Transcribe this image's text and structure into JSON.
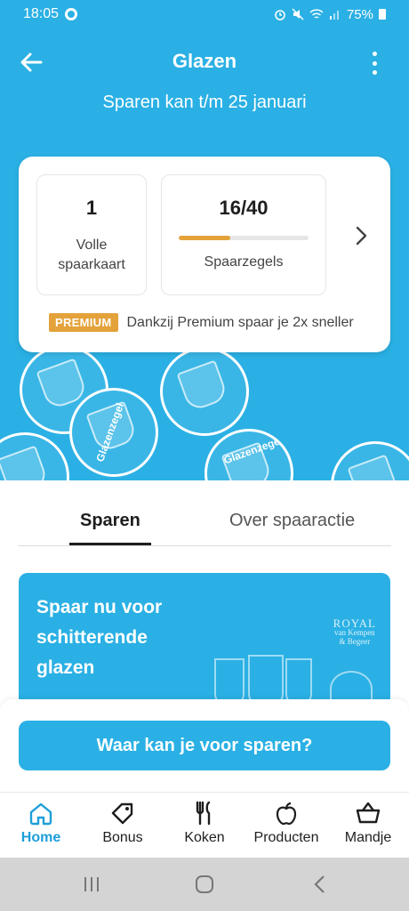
{
  "status_bar": {
    "time": "18:05",
    "battery": "75%"
  },
  "header": {
    "title": "Glazen",
    "subtitle": "Sparen kan t/m 25 januari"
  },
  "stamps_decoration": {
    "stamp_text": "Glazenzegel"
  },
  "savings_card": {
    "full_cards_value": "1",
    "full_cards_label": "Volle spaarkaart",
    "stamps_value": "16/40",
    "stamps_label": "Spaarzegels",
    "stamps_progress": 0.4,
    "premium_badge": "PREMIUM",
    "premium_text": "Dankzij Premium spaar je 2x sneller"
  },
  "tabs": [
    {
      "label": "Sparen",
      "active": true
    },
    {
      "label": "Over spaaractie",
      "active": false
    }
  ],
  "promo": {
    "text": "Spaar nu voor schitterende glazen",
    "brand_line1": "ROYAL",
    "brand_line2": "van Kempen",
    "brand_line3": "& Begeer"
  },
  "cta": {
    "label": "Waar kan je voor sparen?"
  },
  "bottom_nav": [
    {
      "label": "Home",
      "icon": "home-icon",
      "active": true
    },
    {
      "label": "Bonus",
      "icon": "tag-icon",
      "active": false
    },
    {
      "label": "Koken",
      "icon": "cutlery-icon",
      "active": false
    },
    {
      "label": "Producten",
      "icon": "apple-icon",
      "active": false
    },
    {
      "label": "Mandje",
      "icon": "basket-icon",
      "active": false
    }
  ],
  "colors": {
    "brand_blue": "#2ab0e4",
    "accent_orange": "#e3a23a",
    "active_nav": "#1d9fd8"
  }
}
